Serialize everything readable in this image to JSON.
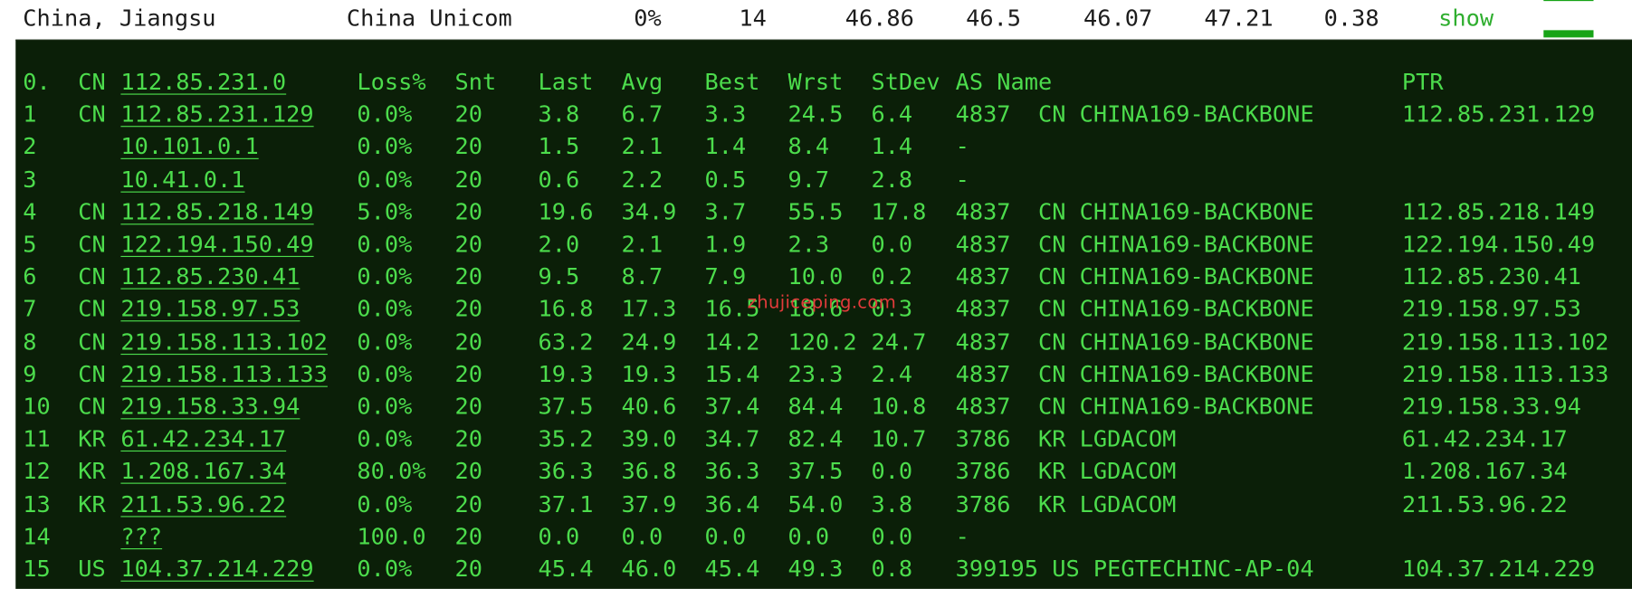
{
  "summary": {
    "location": "China, Jiangsu",
    "isp": "China Unicom",
    "loss": "0%",
    "snt": "14",
    "last": "46.86",
    "avg": "46.5",
    "best": "46.07",
    "worst": "47.21",
    "stdev": "0.38",
    "show_label": "show"
  },
  "header": {
    "hop": "0.",
    "cc": "CN",
    "ip": "112.85.231.0",
    "loss": "Loss%",
    "snt": "Snt",
    "last": "Last",
    "avg": "Avg",
    "best": "Best",
    "wrst": "Wrst",
    "stdev": "StDev",
    "as_name": "AS Name",
    "ptr": "PTR"
  },
  "hops": [
    {
      "hop": "1",
      "cc": "CN",
      "ip": "112.85.231.129",
      "loss": "0.0%",
      "snt": "20",
      "last": "3.8",
      "avg": "6.7",
      "best": "3.3",
      "wrst": "24.5",
      "stdev": "6.4",
      "as": "4837  CN CHINA169-BACKBONE",
      "ptr": "112.85.231.129"
    },
    {
      "hop": "2",
      "cc": "",
      "ip": "10.101.0.1",
      "loss": "0.0%",
      "snt": "20",
      "last": "1.5",
      "avg": "2.1",
      "best": "1.4",
      "wrst": "8.4",
      "stdev": "1.4",
      "as": "-",
      "ptr": ""
    },
    {
      "hop": "3",
      "cc": "",
      "ip": "10.41.0.1",
      "loss": "0.0%",
      "snt": "20",
      "last": "0.6",
      "avg": "2.2",
      "best": "0.5",
      "wrst": "9.7",
      "stdev": "2.8",
      "as": "-",
      "ptr": ""
    },
    {
      "hop": "4",
      "cc": "CN",
      "ip": "112.85.218.149",
      "loss": "5.0%",
      "snt": "20",
      "last": "19.6",
      "avg": "34.9",
      "best": "3.7",
      "wrst": "55.5",
      "stdev": "17.8",
      "as": "4837  CN CHINA169-BACKBONE",
      "ptr": "112.85.218.149"
    },
    {
      "hop": "5",
      "cc": "CN",
      "ip": "122.194.150.49",
      "loss": "0.0%",
      "snt": "20",
      "last": "2.0",
      "avg": "2.1",
      "best": "1.9",
      "wrst": "2.3",
      "stdev": "0.0",
      "as": "4837  CN CHINA169-BACKBONE",
      "ptr": "122.194.150.49"
    },
    {
      "hop": "6",
      "cc": "CN",
      "ip": "112.85.230.41",
      "loss": "0.0%",
      "snt": "20",
      "last": "9.5",
      "avg": "8.7",
      "best": "7.9",
      "wrst": "10.0",
      "stdev": "0.2",
      "as": "4837  CN CHINA169-BACKBONE",
      "ptr": "112.85.230.41"
    },
    {
      "hop": "7",
      "cc": "CN",
      "ip": "219.158.97.53",
      "loss": "0.0%",
      "snt": "20",
      "last": "16.8",
      "avg": "17.3",
      "best": "16.5",
      "wrst": "18.6",
      "stdev": "0.3",
      "as": "4837  CN CHINA169-BACKBONE",
      "ptr": "219.158.97.53"
    },
    {
      "hop": "8",
      "cc": "CN",
      "ip": "219.158.113.102",
      "loss": "0.0%",
      "snt": "20",
      "last": "63.2",
      "avg": "24.9",
      "best": "14.2",
      "wrst": "120.2",
      "stdev": "24.7",
      "as": "4837  CN CHINA169-BACKBONE",
      "ptr": "219.158.113.102"
    },
    {
      "hop": "9",
      "cc": "CN",
      "ip": "219.158.113.133",
      "loss": "0.0%",
      "snt": "20",
      "last": "19.3",
      "avg": "19.3",
      "best": "15.4",
      "wrst": "23.3",
      "stdev": "2.4",
      "as": "4837  CN CHINA169-BACKBONE",
      "ptr": "219.158.113.133"
    },
    {
      "hop": "10",
      "cc": "CN",
      "ip": "219.158.33.94",
      "loss": "0.0%",
      "snt": "20",
      "last": "37.5",
      "avg": "40.6",
      "best": "37.4",
      "wrst": "84.4",
      "stdev": "10.8",
      "as": "4837  CN CHINA169-BACKBONE",
      "ptr": "219.158.33.94"
    },
    {
      "hop": "11",
      "cc": "KR",
      "ip": "61.42.234.17",
      "loss": "0.0%",
      "snt": "20",
      "last": "35.2",
      "avg": "39.0",
      "best": "34.7",
      "wrst": "82.4",
      "stdev": "10.7",
      "as": "3786  KR LGDACOM",
      "ptr": "61.42.234.17"
    },
    {
      "hop": "12",
      "cc": "KR",
      "ip": "1.208.167.34",
      "loss": "80.0%",
      "snt": "20",
      "last": "36.3",
      "avg": "36.8",
      "best": "36.3",
      "wrst": "37.5",
      "stdev": "0.0",
      "as": "3786  KR LGDACOM",
      "ptr": "1.208.167.34"
    },
    {
      "hop": "13",
      "cc": "KR",
      "ip": "211.53.96.22",
      "loss": "0.0%",
      "snt": "20",
      "last": "37.1",
      "avg": "37.9",
      "best": "36.4",
      "wrst": "54.0",
      "stdev": "3.8",
      "as": "3786  KR LGDACOM",
      "ptr": "211.53.96.22"
    },
    {
      "hop": "14",
      "cc": "",
      "ip": "???",
      "loss": "100.0",
      "snt": "20",
      "last": "0.0",
      "avg": "0.0",
      "best": "0.0",
      "wrst": "0.0",
      "stdev": "0.0",
      "as": "-",
      "ptr": ""
    },
    {
      "hop": "15",
      "cc": "US",
      "ip": "104.37.214.229",
      "loss": "0.0%",
      "snt": "20",
      "last": "45.4",
      "avg": "46.0",
      "best": "45.4",
      "wrst": "49.3",
      "stdev": "0.8",
      "as": "399195 US PEGTECHINC-AP-04",
      "ptr": "104.37.214.229"
    }
  ],
  "watermark": "zhujiceping.com",
  "colors": {
    "terminal_bg": "#0b1f08",
    "terminal_text": "#4cdc4c",
    "show_link": "#2fae2f",
    "watermark": "#e23b3b",
    "bar": "#17a417"
  }
}
